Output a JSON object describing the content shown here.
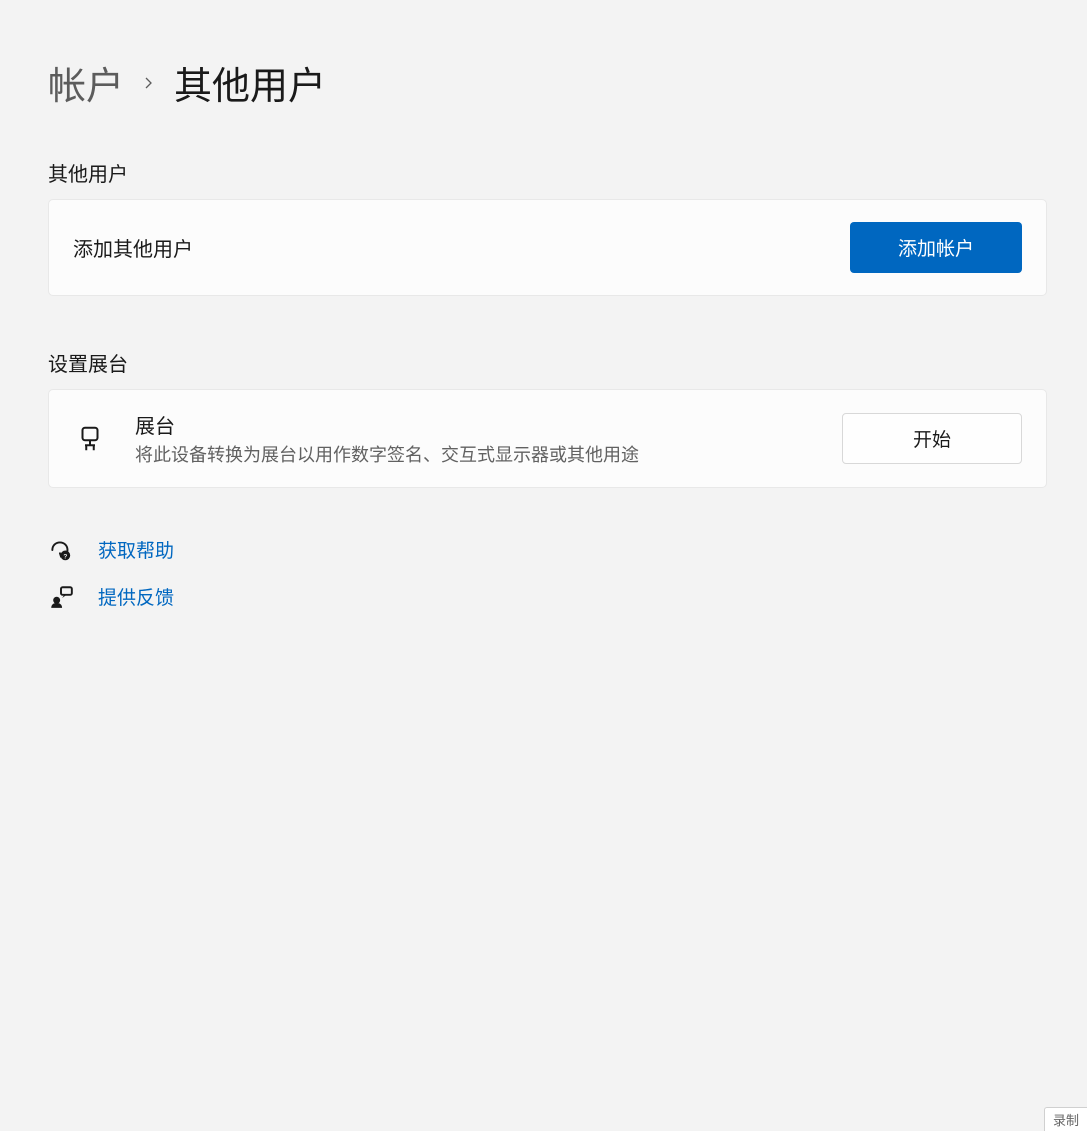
{
  "breadcrumb": {
    "parent": "帐户",
    "current": "其他用户"
  },
  "sections": {
    "other_users": {
      "header": "其他用户",
      "add_label": "添加其他用户",
      "add_button": "添加帐户"
    },
    "kiosk": {
      "header": "设置展台",
      "title": "展台",
      "description": "将此设备转换为展台以用作数字签名、交互式显示器或其他用途",
      "start_button": "开始"
    }
  },
  "links": {
    "help": "获取帮助",
    "feedback": "提供反馈"
  },
  "recording_label": "录制"
}
